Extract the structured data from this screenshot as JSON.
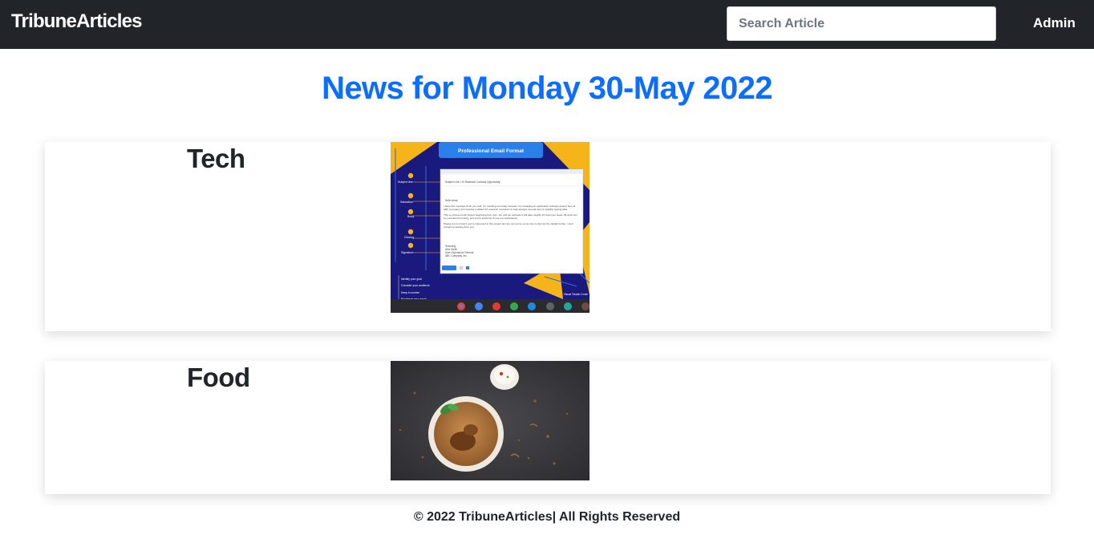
{
  "navbar": {
    "brand": "TribuneArticles",
    "search_placeholder": "Search Article",
    "admin_label": "Admin"
  },
  "page": {
    "title": "News for Monday 30-May 2022"
  },
  "categories": [
    {
      "name": "Tech",
      "image": {
        "banner": "Professional Email Format",
        "steps": [
          "Subject line",
          "Salutation",
          "Body",
          "Closing",
          "Signature"
        ],
        "tips": [
          "Identify your goal",
          "Consider your audience",
          "Keep it concise",
          "Proofread your email"
        ],
        "email_subject": "Subject Line: UX Research Contract Opportunity",
        "email_greeting": "Hello Anna,",
        "email_paragraphs": [
          "I hope this message finds you well. I'm reaching out today because I'm managing an application redesign project here at ABC Company and seeking a skilled UX research contractor to help analyze several sets of usability testing data.",
          "This is a three-month project beginning Feb.-Jan. 1st, and we estimate it will take roughly 15 hours per week. All work can be completed remotely, and you're welcome to use our workspaces.",
          "Please let me know if you're interested in this project and we can set up some time to discuss the details further. I look forward to hearing from you."
        ],
        "email_signoff": [
          "Sincerely,",
          "Alex Smith",
          "User Experience Director",
          "ABC Company, Inc."
        ],
        "watermark": "Visual Studio Code"
      }
    },
    {
      "name": "Food"
    }
  ],
  "footer": {
    "text": "© 2022 TribuneArticles| All Rights Reserved"
  },
  "colors": {
    "navbar_bg": "#212529",
    "title_blue": "#0d6efd",
    "tech_bg": "#1a1a7e",
    "tech_accent": "#f4b41a",
    "food_bg": "#3a3a3d"
  },
  "icons": [
    "search-icon",
    "chrome-icon",
    "files-icon",
    "youtube-icon",
    "play-store-icon",
    "messages-icon",
    "terminal-icon",
    "share-icon"
  ]
}
